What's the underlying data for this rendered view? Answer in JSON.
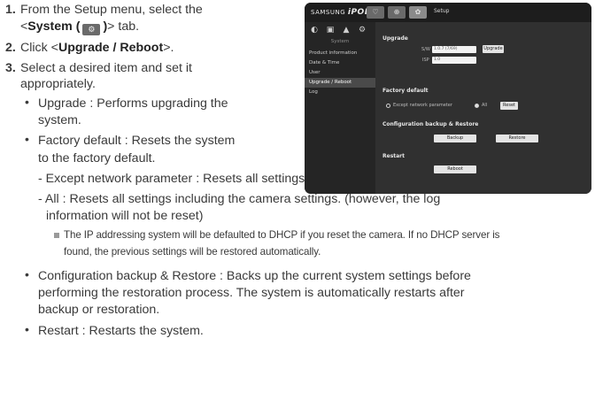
{
  "steps": {
    "s1": {
      "num": "1.",
      "line1": "From the Setup menu, select the",
      "line2_open": "<",
      "line2_bold": "System (",
      "line2_bold_close": ")",
      "line2_close": "> tab."
    },
    "s2": {
      "num": "2.",
      "prefix": "Click <",
      "bold": "Upgrade / Reboot",
      "suffix": ">."
    },
    "s3": {
      "num": "3.",
      "line1": "Select a desired item and set it",
      "line2": "appropriately."
    }
  },
  "bullets": {
    "upgrade": {
      "line1": "Upgrade : Performs upgrading the",
      "line2": "system."
    },
    "factory": {
      "line1": "Factory default : Resets the system",
      "line2": "to the factory default."
    },
    "dash_except": "- Except network parameter : Resets all settings except for the Network settings.",
    "dash_all_line1": "- All : Resets all settings including the camera settings. (however, the log",
    "dash_all_line2": "information will not be reset)",
    "note_line1": "The IP addressing system will be defaulted to DHCP if you reset the camera. If no DHCP server is",
    "note_line2": "found, the previous settings will be restored automatically.",
    "config": {
      "line1": "Configuration backup & Restore : Backs up the current system settings before",
      "line2": "performing the restoration process. The system is automatically restarts after",
      "line3": "backup or restoration."
    },
    "restart": "Restart : Restarts the system."
  },
  "screenshot": {
    "brand": "SAMSUNG",
    "brand_product": "iPOLIS",
    "top_label": "Setup",
    "side_heading": "System",
    "side_items": [
      "Product information",
      "Date & Time",
      "User",
      "Upgrade / Reboot",
      "Log"
    ],
    "sections": {
      "upgrade": "Upgrade",
      "factory": "Factory default",
      "config": "Configuration backup & Restore",
      "restart": "Restart"
    },
    "fields": {
      "sw_label": "S/W",
      "sw_value": "1.0.7 (7/69)",
      "isp_label": "ISP",
      "isp_value": "1.0"
    },
    "buttons": {
      "upgrade": "Upgrade",
      "reset": "Reset",
      "backup": "Backup",
      "restore": "Restore",
      "reboot": "Reboot"
    },
    "radios": {
      "except": "Except network parameter",
      "all": "All"
    }
  },
  "colors": {
    "text": "#3a3a3a",
    "ui_dark": "#2b2b2b",
    "ui_topbar": "#1d1d1d"
  }
}
